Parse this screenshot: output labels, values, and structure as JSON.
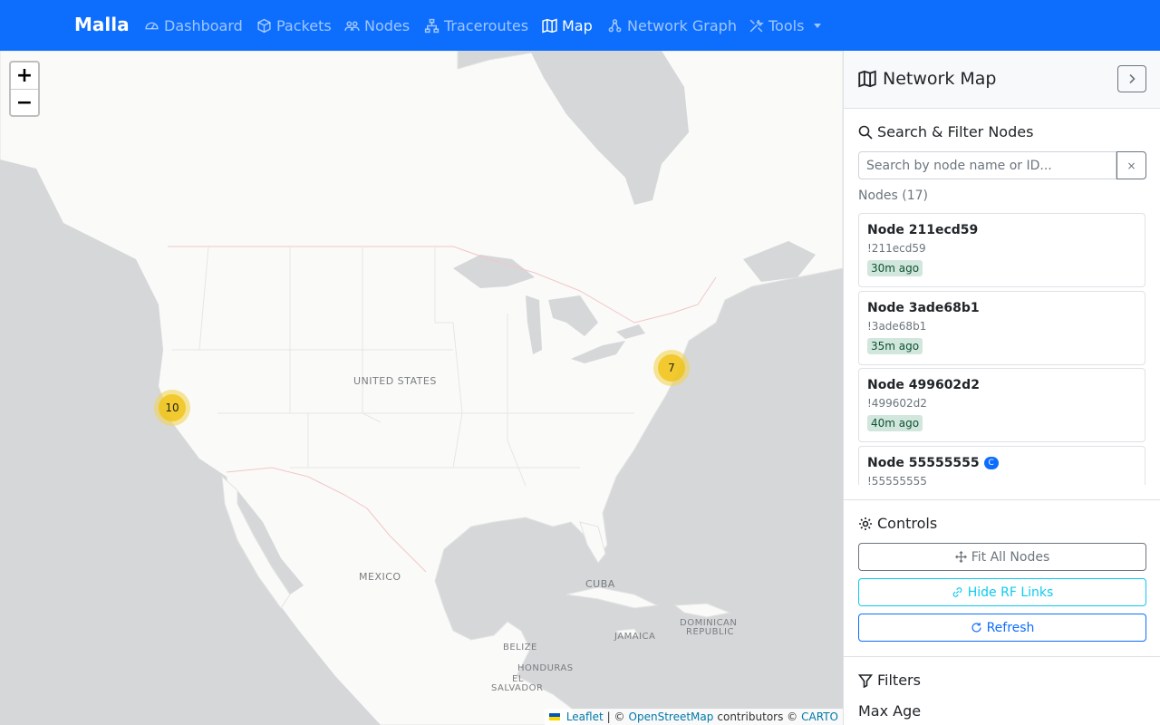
{
  "navbar": {
    "brand": "Malla",
    "items": [
      {
        "label": "Dashboard",
        "icon": "speedometer-icon"
      },
      {
        "label": "Packets",
        "icon": "box-icon"
      },
      {
        "label": "Nodes",
        "icon": "people-icon"
      },
      {
        "label": "Traceroutes",
        "icon": "diagram-icon"
      },
      {
        "label": "Map",
        "icon": "map-icon",
        "active": true
      },
      {
        "label": "Network Graph",
        "icon": "network-icon"
      },
      {
        "label": "Tools",
        "icon": "tools-icon",
        "dropdown": true
      }
    ]
  },
  "map": {
    "zoom_in": "+",
    "zoom_out": "−",
    "labels": {
      "us": "UNITED STATES",
      "mexico": "MEXICO",
      "cuba": "CUBA",
      "jamaica": "JAMAICA",
      "dominican_1": "DOMINICAN",
      "dominican_2": "REPUBLIC",
      "belize": "BELIZE",
      "honduras": "HONDURAS",
      "el_salvador_1": "EL",
      "el_salvador_2": "SALVADOR"
    },
    "clusters": [
      {
        "count": "10",
        "color": "#f0c20c"
      },
      {
        "count": "7",
        "color": "#f0c20c"
      }
    ],
    "attribution": {
      "leaflet": "Leaflet",
      "sep1": "| ©",
      "osm": "OpenStreetMap",
      "contributors": "contributors ©",
      "carto": "CARTO"
    }
  },
  "sidebar": {
    "title": "Network Map",
    "search_section": "Search & Filter Nodes",
    "search_placeholder": "Search by node name or ID...",
    "clear_label": "×",
    "nodes_count": "Nodes (17)",
    "nodes": [
      {
        "name": "Node 211ecd59",
        "id": "!211ecd59",
        "age": "30m ago"
      },
      {
        "name": "Node 3ade68b1",
        "id": "!3ade68b1",
        "age": "35m ago"
      },
      {
        "name": "Node 499602d2",
        "id": "!499602d2",
        "age": "40m ago"
      },
      {
        "name": "Node 55555555",
        "id": "!55555555",
        "badge": "C"
      }
    ],
    "controls_title": "Controls",
    "controls": {
      "fit": "Fit All Nodes",
      "rf": "Hide RF Links",
      "refresh": "Refresh"
    },
    "filters_title": "Filters",
    "max_age_label": "Max Age"
  },
  "colors": {
    "navbar_bg": "#0d6efd",
    "age_badge_bg": "#d1e7dd",
    "cluster": "#f0c20c"
  }
}
